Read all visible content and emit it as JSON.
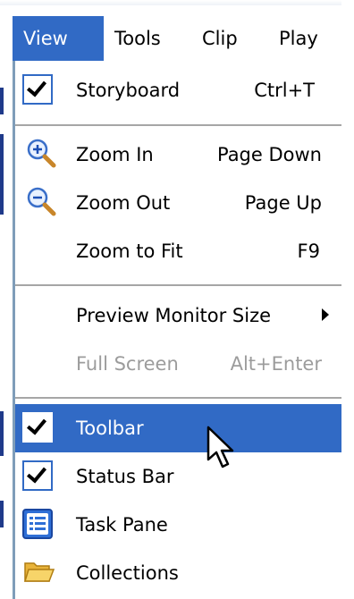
{
  "menubar": {
    "items": [
      {
        "label": "View"
      },
      {
        "label": "Tools"
      },
      {
        "label": "Clip"
      },
      {
        "label": "Play"
      }
    ]
  },
  "view_menu": {
    "items": [
      {
        "label": "Storyboard",
        "shortcut": "Ctrl+T",
        "icon": "checkmark-icon",
        "checked": true
      },
      {
        "label": "Zoom In",
        "shortcut": "Page Down",
        "icon": "zoom-in-icon"
      },
      {
        "label": "Zoom Out",
        "shortcut": "Page Up",
        "icon": "zoom-out-icon"
      },
      {
        "label": "Zoom to Fit",
        "shortcut": "F9"
      },
      {
        "label": "Preview Monitor Size",
        "submenu": true
      },
      {
        "label": "Full Screen",
        "shortcut": "Alt+Enter",
        "disabled": true
      },
      {
        "label": "Toolbar",
        "icon": "checkmark-icon",
        "checked": true,
        "highlighted": true
      },
      {
        "label": "Status Bar",
        "icon": "checkmark-icon",
        "checked": true
      },
      {
        "label": "Task Pane",
        "icon": "task-pane-icon"
      },
      {
        "label": "Collections",
        "icon": "folder-icon"
      }
    ]
  },
  "colors": {
    "highlight": "#316ac5",
    "disabled_text": "#9c9c9c",
    "separator": "#a6a6a6"
  }
}
